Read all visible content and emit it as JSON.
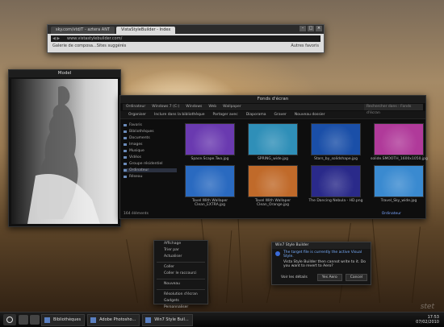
{
  "browser": {
    "tabs": [
      "sky.com/vtd/T - aztera ANT",
      "VistaStyleBuilder - Index"
    ],
    "url": "www.vistastylebuilder.com/",
    "bookmarks": {
      "left": "Galerie de composa...",
      "middle": "Sites suggérés",
      "right": "Autres favoris"
    }
  },
  "model": {
    "title": "Model"
  },
  "explorer": {
    "title": "Fonds d'écran",
    "breadcrumb": [
      "Ordinateur",
      "Windows 7 (C:)",
      "Windows",
      "Web",
      "Wallpaper"
    ],
    "search_placeholder": "Rechercher dans : Fonds d'écran",
    "commands": [
      "Organiser",
      "Inclure dans la bibliothèque",
      "Partager avec",
      "Diaporama",
      "Graver",
      "Nouveau dossier"
    ],
    "sidebar": [
      "Favoris",
      "Bibliothèques",
      "Documents",
      "Images",
      "Musique",
      "Vidéos",
      "Groupe résidentiel",
      "Ordinateur",
      "Réseau"
    ],
    "files": [
      {
        "name": "Space.Scape.Two.jpg",
        "color": "#6a3ab0"
      },
      {
        "name": "SPRING_wide.jpg",
        "color": "#2f8fb8"
      },
      {
        "name": "Stars_by_solidshape.jpg",
        "color": "#1a4fa8"
      },
      {
        "name": "solide.SMOOTH_1600x1050.jpg",
        "color": "#b03a9a"
      },
      {
        "name": "Tavel With Wallaper Clean_EXTRA.jpg",
        "color": "#2a6ac0"
      },
      {
        "name": "Tavel With Wallaper Clean_Orange.jpg",
        "color": "#c06a2a"
      },
      {
        "name": "The Dancing Nebula - HD.png",
        "color": "#2a2a8a"
      },
      {
        "name": "Travel_Sky_wide.jpg",
        "color": "#3a8ad0"
      }
    ],
    "status": "164 éléments",
    "status_right": "Ordinateur"
  },
  "context_menu": [
    "Affichage",
    "Trier par",
    "Actualiser",
    "Coller",
    "Coller le raccourci",
    "Nouveau",
    "Résolution d'écran",
    "Gadgets",
    "Personnaliser"
  ],
  "dialog": {
    "title": "Win7 Style Builder",
    "message": "The target file is currently the active Visual Style.",
    "detail": "Vista Style Builder then cannot write to it. Do you want to revert to Aero?",
    "buttons": [
      "Voir les détails",
      "Yes Aero",
      "Cancel"
    ]
  },
  "taskbar": {
    "tasks": [
      "Bibliothèques",
      "Adobe Photosho...",
      "Win7 Style Buil..."
    ],
    "time": "17:53",
    "date": "07/02/2010"
  },
  "watermark": "stet"
}
